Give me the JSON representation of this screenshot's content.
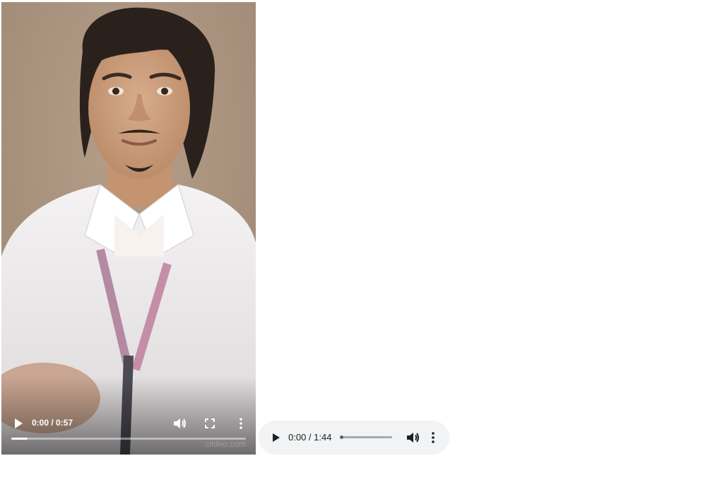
{
  "video": {
    "current_time": "0:00",
    "separator": " / ",
    "duration": "0:57",
    "progress_fraction": 0.07,
    "watermark": "clideo.com",
    "icons": {
      "play": "play-icon",
      "volume": "volume-icon",
      "fullscreen": "fullscreen-icon",
      "more": "more-vert-icon"
    }
  },
  "audio": {
    "time_display": "0:00 / 1:44",
    "progress_fraction": 0.0,
    "icons": {
      "play": "play-icon",
      "volume": "volume-icon",
      "more": "more-vert-icon"
    }
  },
  "colors": {
    "audio_bg": "#f1f3f4",
    "video_controls_text": "#ffffff"
  }
}
